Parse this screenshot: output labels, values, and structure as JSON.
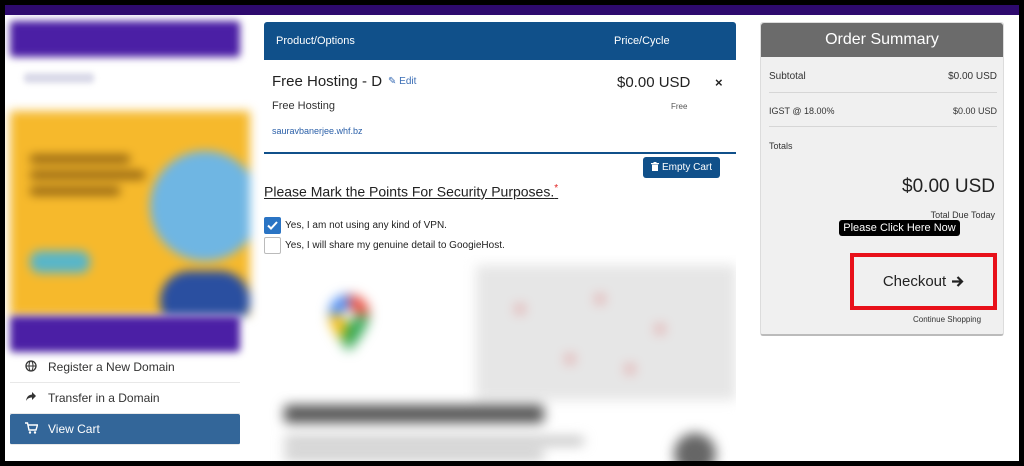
{
  "main": {
    "table_header": {
      "product_col": "Product/Options",
      "price_col": "Price/Cycle"
    },
    "product": {
      "name": "Free Hosting - D",
      "edit_label": "Edit",
      "price": "$0.00 USD",
      "remove_symbol": "×",
      "subtitle": "Free Hosting",
      "cycle": "Free",
      "domain": "sauravbanerjee.whf.bz"
    },
    "empty_cart_label": "Empty Cart",
    "security": {
      "title": "Please Mark the Points For Security Purposes.",
      "required_mark": "*",
      "options": [
        {
          "label": "Yes, I am not using any kind of VPN.",
          "checked": true
        },
        {
          "label": "Yes, I will share my genuine detail to GoogieHost.",
          "checked": false
        }
      ]
    }
  },
  "sidebar": {
    "items": [
      {
        "label": "Register a New Domain",
        "icon": "globe-icon",
        "active": false
      },
      {
        "label": "Transfer in a Domain",
        "icon": "share-arrow-icon",
        "active": false
      },
      {
        "label": "View Cart",
        "icon": "cart-icon",
        "active": true
      }
    ]
  },
  "summary": {
    "title": "Order Summary",
    "subtotal_label": "Subtotal",
    "subtotal_value": "$0.00 USD",
    "tax_label": "IGST @ 18.00%",
    "tax_value": "$0.00 USD",
    "totals_label": "Totals",
    "total_value": "$0.00 USD",
    "total_due_label": "Total Due Today",
    "tooltip": "Please Click Here Now",
    "checkout_label": "Checkout",
    "continue_label": "Continue Shopping"
  },
  "colors": {
    "topbar": "#2e0a6e",
    "table_header": "#10508a",
    "active_nav": "#336699",
    "highlight": "#e8101a"
  }
}
